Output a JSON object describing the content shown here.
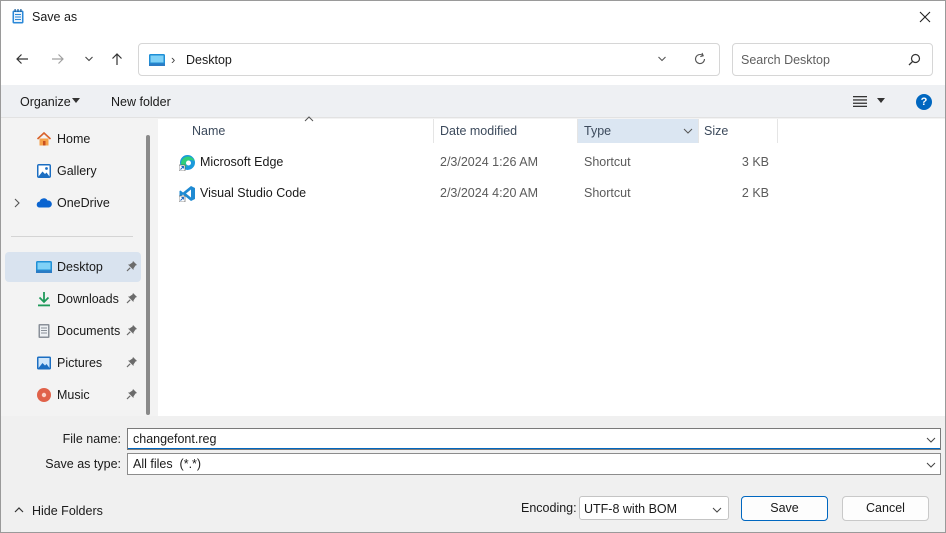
{
  "window": {
    "title": "Save as"
  },
  "nav": {
    "address": {
      "location": "Desktop",
      "separator": "›"
    },
    "search": {
      "placeholder": "Search Desktop"
    }
  },
  "commands": {
    "organize": "Organize",
    "new_folder": "New folder"
  },
  "sidebar": {
    "items": [
      {
        "label": "Home",
        "icon": "home-icon"
      },
      {
        "label": "Gallery",
        "icon": "gallery-icon"
      },
      {
        "label": "OneDrive",
        "icon": "onedrive-icon",
        "expandable": true
      },
      {
        "label": "Desktop",
        "icon": "desktop-folder-icon",
        "pinned": true,
        "selected": true
      },
      {
        "label": "Downloads",
        "icon": "download-icon",
        "pinned": true
      },
      {
        "label": "Documents",
        "icon": "documents-icon",
        "pinned": true
      },
      {
        "label": "Pictures",
        "icon": "pictures-icon",
        "pinned": true
      },
      {
        "label": "Music",
        "icon": "music-icon",
        "pinned": true
      }
    ]
  },
  "file_list": {
    "columns": {
      "name": "Name",
      "date": "Date modified",
      "type": "Type",
      "size": "Size"
    },
    "rows": [
      {
        "name": "Microsoft Edge",
        "date": "2/3/2024 1:26 AM",
        "type": "Shortcut",
        "size": "3 KB",
        "icon": "edge-icon"
      },
      {
        "name": "Visual Studio Code",
        "date": "2/3/2024 4:20 AM",
        "type": "Shortcut",
        "size": "2 KB",
        "icon": "vscode-icon"
      }
    ]
  },
  "form": {
    "file_name_label": "File name:",
    "file_name_value": "changefont.reg",
    "save_as_type_label": "Save as type:",
    "save_as_type_value": "All files  (*.*)"
  },
  "footer": {
    "hide_folders": "Hide Folders",
    "encoding_label": "Encoding:",
    "encoding_value": "UTF-8 with BOM",
    "save": "Save",
    "cancel": "Cancel"
  },
  "colors": {
    "accent": "#0067c0",
    "selected_bg": "#d9e3ef",
    "type_header_bg": "#dbe6f2"
  }
}
